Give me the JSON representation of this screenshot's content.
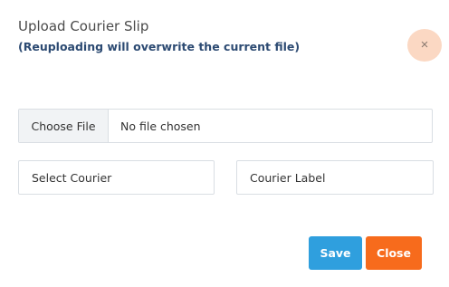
{
  "modal": {
    "title": "Upload Courier Slip",
    "subtitle": "(Reuploading will overwrite the current file)",
    "close_icon": "×"
  },
  "file_upload": {
    "button_label": "Choose File",
    "status": "No file chosen"
  },
  "courier_select": {
    "selected": "Select Courier"
  },
  "courier_label": {
    "placeholder": "Courier Label",
    "value": ""
  },
  "actions": {
    "save_label": "Save",
    "close_label": "Close"
  },
  "colors": {
    "save": "#2f9fde",
    "close": "#f76b1c",
    "close_icon_bg": "#fbd8c3",
    "subtitle": "#2c4a72"
  },
  "icons": {
    "close_icon": "close-icon"
  }
}
